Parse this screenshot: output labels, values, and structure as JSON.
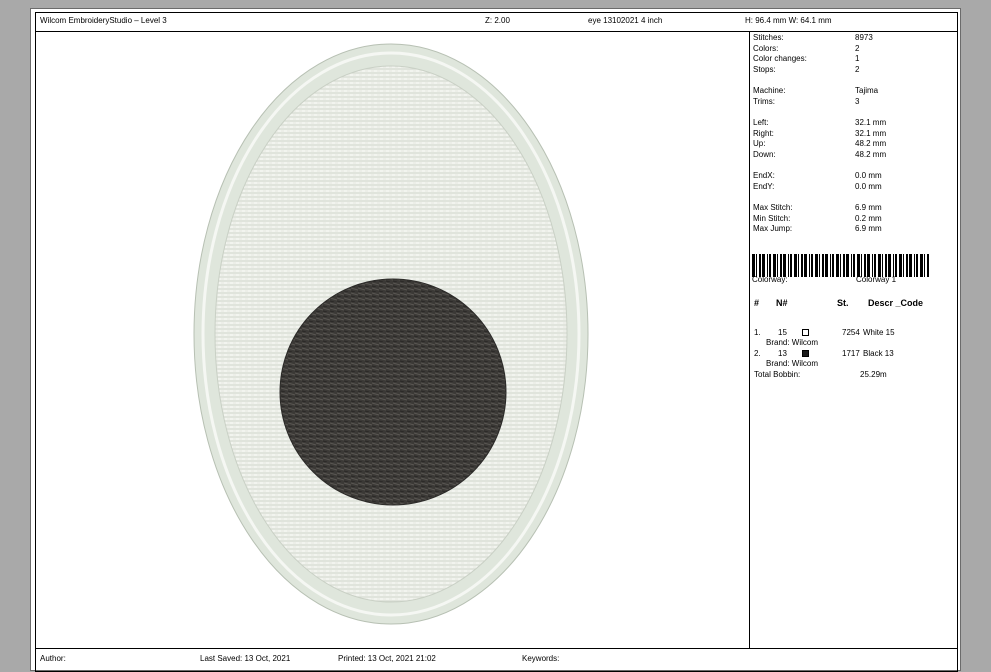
{
  "header": {
    "app_title": "Wilcom EmbroideryStudio – Level 3",
    "zoom": "Z: 2.00",
    "design_name": "eye 13102021 4 inch",
    "dimensions": "H: 96.4 mm   W: 64.1 mm"
  },
  "stats": [
    {
      "label": "Stitches:",
      "value": "8973"
    },
    {
      "label": "Colors:",
      "value": "2"
    },
    {
      "label": "Color changes:",
      "value": "1"
    },
    {
      "label": "Stops:",
      "value": "2"
    },
    {
      "label": "Machine:",
      "value": "Tajima"
    },
    {
      "label": "Trims:",
      "value": "3"
    },
    {
      "label": "Left:",
      "value": "32.1 mm"
    },
    {
      "label": "Right:",
      "value": "32.1 mm"
    },
    {
      "label": "Up:",
      "value": "48.2 mm"
    },
    {
      "label": "Down:",
      "value": "48.2 mm"
    },
    {
      "label": "EndX:",
      "value": "0.0 mm"
    },
    {
      "label": "EndY:",
      "value": "0.0 mm"
    },
    {
      "label": "Max Stitch:",
      "value": "6.9 mm"
    },
    {
      "label": "Min Stitch:",
      "value": "0.2 mm"
    },
    {
      "label": "Max Jump:",
      "value": "6.9 mm"
    }
  ],
  "colorway": {
    "label": "Colorway:",
    "value": "Colorway 1"
  },
  "color_table": {
    "headers": {
      "num": "#",
      "n": "N#",
      "st": "St.",
      "desc": "Descr _Code"
    },
    "rows": [
      {
        "index": "1.",
        "n": "15",
        "swatch_color": "#ffffff",
        "stitches": "7254",
        "desc": "White 15",
        "brand": "Brand: Wilcom"
      },
      {
        "index": "2.",
        "n": "13",
        "swatch_color": "#1a1a1a",
        "stitches": "1717",
        "desc": "Black 13",
        "brand": "Brand: Wilcom"
      }
    ],
    "total_bobbin_label": "Total Bobbin:",
    "total_bobbin_value": "25.29m"
  },
  "footer": {
    "author": "Author:",
    "last_saved": "Last Saved: 13 Oct, 2021",
    "printed": "Printed: 13 Oct, 2021 21:02",
    "keywords": "Keywords:"
  },
  "colors": {
    "border_thread": "#dfe6dc",
    "fill_thread": "#ecefe8",
    "pupil_thread": "#3b3936"
  }
}
